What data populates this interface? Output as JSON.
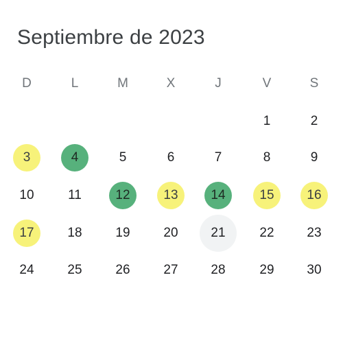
{
  "calendar": {
    "title": "Septiembre de 2023",
    "weekdays": [
      "D",
      "L",
      "M",
      "X",
      "J",
      "V",
      "S"
    ],
    "colors": {
      "green": "#57b17c",
      "yellow": "#f7f27a",
      "today": "#f1f3f4"
    },
    "weeks": [
      [
        {
          "label": "",
          "status": "none"
        },
        {
          "label": "",
          "status": "none"
        },
        {
          "label": "",
          "status": "none"
        },
        {
          "label": "",
          "status": "none"
        },
        {
          "label": "",
          "status": "none"
        },
        {
          "label": "1",
          "status": "none"
        },
        {
          "label": "2",
          "status": "none"
        }
      ],
      [
        {
          "label": "3",
          "status": "yellow"
        },
        {
          "label": "4",
          "status": "green"
        },
        {
          "label": "5",
          "status": "none"
        },
        {
          "label": "6",
          "status": "none"
        },
        {
          "label": "7",
          "status": "none"
        },
        {
          "label": "8",
          "status": "none"
        },
        {
          "label": "9",
          "status": "none"
        }
      ],
      [
        {
          "label": "10",
          "status": "none"
        },
        {
          "label": "11",
          "status": "none"
        },
        {
          "label": "12",
          "status": "green"
        },
        {
          "label": "13",
          "status": "yellow"
        },
        {
          "label": "14",
          "status": "green"
        },
        {
          "label": "15",
          "status": "yellow"
        },
        {
          "label": "16",
          "status": "yellow"
        }
      ],
      [
        {
          "label": "17",
          "status": "yellow"
        },
        {
          "label": "18",
          "status": "none"
        },
        {
          "label": "19",
          "status": "none"
        },
        {
          "label": "20",
          "status": "none"
        },
        {
          "label": "21",
          "status": "today"
        },
        {
          "label": "22",
          "status": "none"
        },
        {
          "label": "23",
          "status": "none"
        }
      ],
      [
        {
          "label": "24",
          "status": "none"
        },
        {
          "label": "25",
          "status": "none"
        },
        {
          "label": "26",
          "status": "none"
        },
        {
          "label": "27",
          "status": "none"
        },
        {
          "label": "28",
          "status": "none"
        },
        {
          "label": "29",
          "status": "none"
        },
        {
          "label": "30",
          "status": "none"
        }
      ]
    ]
  }
}
